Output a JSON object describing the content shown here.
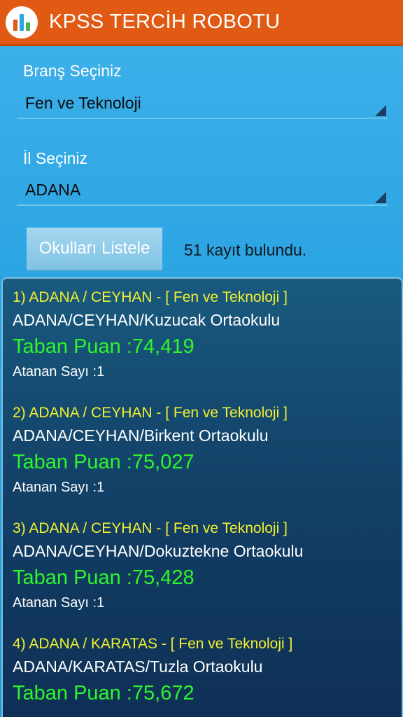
{
  "appbar": {
    "title": "KPSS TERCİH ROBOTU",
    "icon": "bar-chart-icon",
    "colors": {
      "background": "#e05a14",
      "icon_bars": [
        "#e05a14",
        "#2aa4e2",
        "#4caf50"
      ]
    }
  },
  "branch": {
    "label": "Branş Seçiniz",
    "selected": "Fen ve Teknoloji"
  },
  "city": {
    "label": "İl Seçiniz",
    "selected": "ADANA"
  },
  "actions": {
    "list_button": "Okulları Listele",
    "result_count": "51 kayıt bulundu."
  },
  "results": [
    {
      "header": "1) ADANA / CEYHAN - [ Fen ve Teknoloji ]",
      "school": "ADANA/CEYHAN/Kuzucak Ortaokulu",
      "score": "Taban Puan :74,419",
      "assigned": "Atanan Sayı :1"
    },
    {
      "header": "2) ADANA / CEYHAN - [ Fen ve Teknoloji ]",
      "school": "ADANA/CEYHAN/Birkent Ortaokulu",
      "score": "Taban Puan :75,027",
      "assigned": "Atanan Sayı :1"
    },
    {
      "header": "3) ADANA / CEYHAN - [ Fen ve Teknoloji ]",
      "school": "ADANA/CEYHAN/Dokuztekne Ortaokulu",
      "score": "Taban Puan :75,428",
      "assigned": "Atanan Sayı :1"
    },
    {
      "header": "4) ADANA / KARATAS - [ Fen ve Teknoloji ]",
      "school": "ADANA/KARATAS/Tuzla Ortaokulu",
      "score": "Taban Puan :75,672",
      "assigned": ""
    }
  ],
  "colors": {
    "background": "#2aa4e2",
    "list_background": "#123f66",
    "header_text": "#f2f02e",
    "score_text": "#2ef52b"
  }
}
